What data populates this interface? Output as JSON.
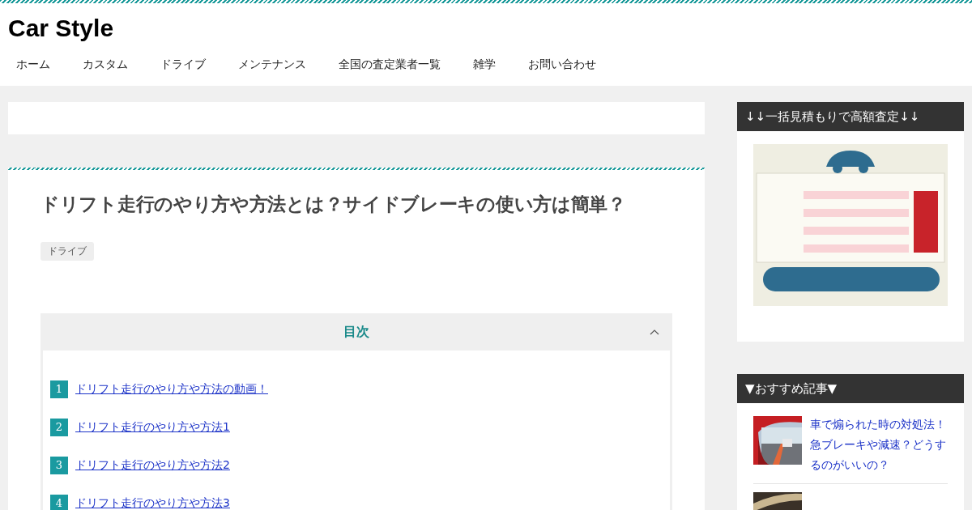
{
  "site": {
    "title": "Car Style"
  },
  "nav": [
    {
      "label": "ホーム"
    },
    {
      "label": "カスタム"
    },
    {
      "label": "ドライブ"
    },
    {
      "label": "メンテナンス"
    },
    {
      "label": "全国の査定業者一覧"
    },
    {
      "label": "雑学"
    },
    {
      "label": "お問い合わせ"
    }
  ],
  "article": {
    "title": "ドリフト走行のやり方や方法とは？サイドブレーキの使い方は簡単？",
    "category": "ドライブ",
    "toc": {
      "title": "目次",
      "expanded": true,
      "items": [
        {
          "number": "1",
          "label": "ドリフト走行のやり方や方法の動画！"
        },
        {
          "number": "2",
          "label": "ドリフト走行のやり方や方法1"
        },
        {
          "number": "3",
          "label": "ドリフト走行のやり方や方法2"
        },
        {
          "number": "4",
          "label": "ドリフト走行のやり方や方法3"
        }
      ]
    }
  },
  "sidebar": [
    {
      "kind": "banner",
      "heading": "↓↓一括見積もりで高額査定↓↓",
      "banner": {
        "kind": "picture"
      }
    },
    {
      "kind": "articles",
      "heading": "▼おすすめ記事▼",
      "items": [
        {
          "thumbnail": {
            "kind": "picture"
          },
          "title": "車で煽られた時の対処法！急ブレーキや減速？どうするのがいいの？"
        },
        {
          "thumbnail": {
            "kind": "picture"
          }
        }
      ]
    }
  ]
}
